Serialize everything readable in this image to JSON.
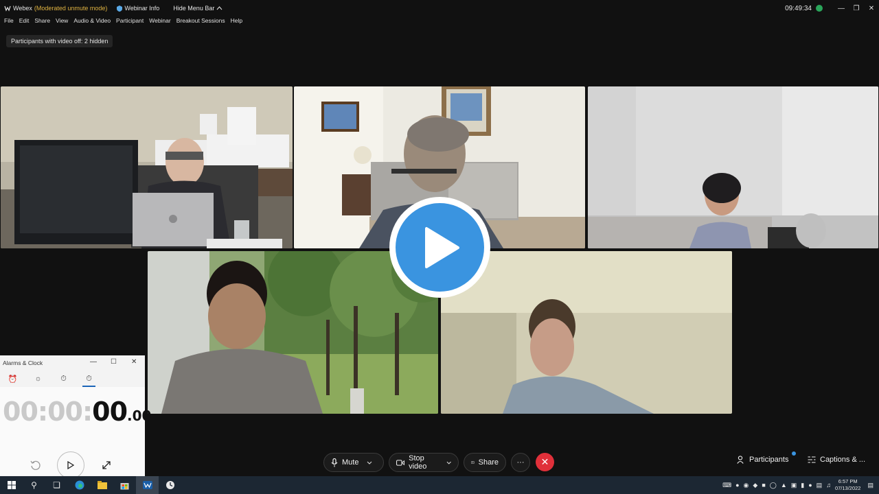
{
  "titlebar": {
    "app": "Webex",
    "mode": "(Moderated unmute mode)",
    "webinar_info": "Webinar Info",
    "hide_menu_bar": "Hide Menu Bar",
    "clock": "09:49:34"
  },
  "menu": [
    "File",
    "Edit",
    "Share",
    "View",
    "Audio & Video",
    "Participant",
    "Webinar",
    "Breakout Sessions",
    "Help"
  ],
  "video_off_notice": "Participants with video off: 2 hidden",
  "alarms_clock": {
    "title": "Alarms & Clock",
    "stopwatch_dim": "00:00:",
    "stopwatch_seconds": "00",
    "stopwatch_ms": ".00",
    "tabs": [
      "alarm-icon",
      "world-clock-icon",
      "timer-icon",
      "stopwatch-icon"
    ],
    "active_tab": "stopwatch-icon"
  },
  "controls": {
    "mute": "Mute",
    "stop_video": "Stop video",
    "share": "Share",
    "more": "···",
    "participants": "Participants",
    "captions": "Captions & ..."
  },
  "taskbar": {
    "time": "6:57 PM",
    "date": "07/13/2022"
  },
  "colors": {
    "accent_blue": "#3a94e0",
    "end_call": "#e0303a",
    "mode_text": "#e0b341",
    "status_green": "#2aa55a"
  }
}
